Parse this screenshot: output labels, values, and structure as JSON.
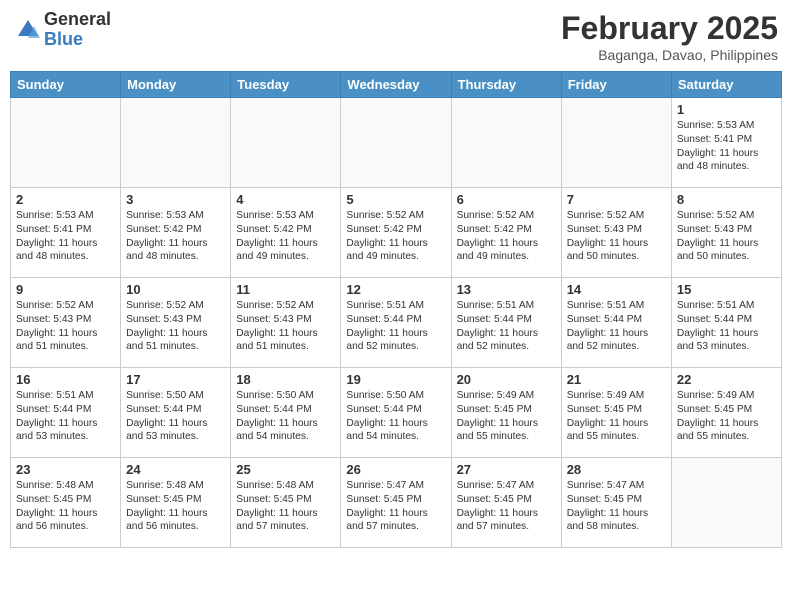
{
  "header": {
    "logo_line1": "General",
    "logo_line2": "Blue",
    "month_year": "February 2025",
    "location": "Baganga, Davao, Philippines"
  },
  "weekdays": [
    "Sunday",
    "Monday",
    "Tuesday",
    "Wednesday",
    "Thursday",
    "Friday",
    "Saturday"
  ],
  "weeks": [
    [
      {
        "day": "",
        "info": ""
      },
      {
        "day": "",
        "info": ""
      },
      {
        "day": "",
        "info": ""
      },
      {
        "day": "",
        "info": ""
      },
      {
        "day": "",
        "info": ""
      },
      {
        "day": "",
        "info": ""
      },
      {
        "day": "1",
        "info": "Sunrise: 5:53 AM\nSunset: 5:41 PM\nDaylight: 11 hours\nand 48 minutes."
      }
    ],
    [
      {
        "day": "2",
        "info": "Sunrise: 5:53 AM\nSunset: 5:41 PM\nDaylight: 11 hours\nand 48 minutes."
      },
      {
        "day": "3",
        "info": "Sunrise: 5:53 AM\nSunset: 5:42 PM\nDaylight: 11 hours\nand 48 minutes."
      },
      {
        "day": "4",
        "info": "Sunrise: 5:53 AM\nSunset: 5:42 PM\nDaylight: 11 hours\nand 49 minutes."
      },
      {
        "day": "5",
        "info": "Sunrise: 5:52 AM\nSunset: 5:42 PM\nDaylight: 11 hours\nand 49 minutes."
      },
      {
        "day": "6",
        "info": "Sunrise: 5:52 AM\nSunset: 5:42 PM\nDaylight: 11 hours\nand 49 minutes."
      },
      {
        "day": "7",
        "info": "Sunrise: 5:52 AM\nSunset: 5:43 PM\nDaylight: 11 hours\nand 50 minutes."
      },
      {
        "day": "8",
        "info": "Sunrise: 5:52 AM\nSunset: 5:43 PM\nDaylight: 11 hours\nand 50 minutes."
      }
    ],
    [
      {
        "day": "9",
        "info": "Sunrise: 5:52 AM\nSunset: 5:43 PM\nDaylight: 11 hours\nand 51 minutes."
      },
      {
        "day": "10",
        "info": "Sunrise: 5:52 AM\nSunset: 5:43 PM\nDaylight: 11 hours\nand 51 minutes."
      },
      {
        "day": "11",
        "info": "Sunrise: 5:52 AM\nSunset: 5:43 PM\nDaylight: 11 hours\nand 51 minutes."
      },
      {
        "day": "12",
        "info": "Sunrise: 5:51 AM\nSunset: 5:44 PM\nDaylight: 11 hours\nand 52 minutes."
      },
      {
        "day": "13",
        "info": "Sunrise: 5:51 AM\nSunset: 5:44 PM\nDaylight: 11 hours\nand 52 minutes."
      },
      {
        "day": "14",
        "info": "Sunrise: 5:51 AM\nSunset: 5:44 PM\nDaylight: 11 hours\nand 52 minutes."
      },
      {
        "day": "15",
        "info": "Sunrise: 5:51 AM\nSunset: 5:44 PM\nDaylight: 11 hours\nand 53 minutes."
      }
    ],
    [
      {
        "day": "16",
        "info": "Sunrise: 5:51 AM\nSunset: 5:44 PM\nDaylight: 11 hours\nand 53 minutes."
      },
      {
        "day": "17",
        "info": "Sunrise: 5:50 AM\nSunset: 5:44 PM\nDaylight: 11 hours\nand 53 minutes."
      },
      {
        "day": "18",
        "info": "Sunrise: 5:50 AM\nSunset: 5:44 PM\nDaylight: 11 hours\nand 54 minutes."
      },
      {
        "day": "19",
        "info": "Sunrise: 5:50 AM\nSunset: 5:44 PM\nDaylight: 11 hours\nand 54 minutes."
      },
      {
        "day": "20",
        "info": "Sunrise: 5:49 AM\nSunset: 5:45 PM\nDaylight: 11 hours\nand 55 minutes."
      },
      {
        "day": "21",
        "info": "Sunrise: 5:49 AM\nSunset: 5:45 PM\nDaylight: 11 hours\nand 55 minutes."
      },
      {
        "day": "22",
        "info": "Sunrise: 5:49 AM\nSunset: 5:45 PM\nDaylight: 11 hours\nand 55 minutes."
      }
    ],
    [
      {
        "day": "23",
        "info": "Sunrise: 5:48 AM\nSunset: 5:45 PM\nDaylight: 11 hours\nand 56 minutes."
      },
      {
        "day": "24",
        "info": "Sunrise: 5:48 AM\nSunset: 5:45 PM\nDaylight: 11 hours\nand 56 minutes."
      },
      {
        "day": "25",
        "info": "Sunrise: 5:48 AM\nSunset: 5:45 PM\nDaylight: 11 hours\nand 57 minutes."
      },
      {
        "day": "26",
        "info": "Sunrise: 5:47 AM\nSunset: 5:45 PM\nDaylight: 11 hours\nand 57 minutes."
      },
      {
        "day": "27",
        "info": "Sunrise: 5:47 AM\nSunset: 5:45 PM\nDaylight: 11 hours\nand 57 minutes."
      },
      {
        "day": "28",
        "info": "Sunrise: 5:47 AM\nSunset: 5:45 PM\nDaylight: 11 hours\nand 58 minutes."
      },
      {
        "day": "",
        "info": ""
      }
    ]
  ]
}
